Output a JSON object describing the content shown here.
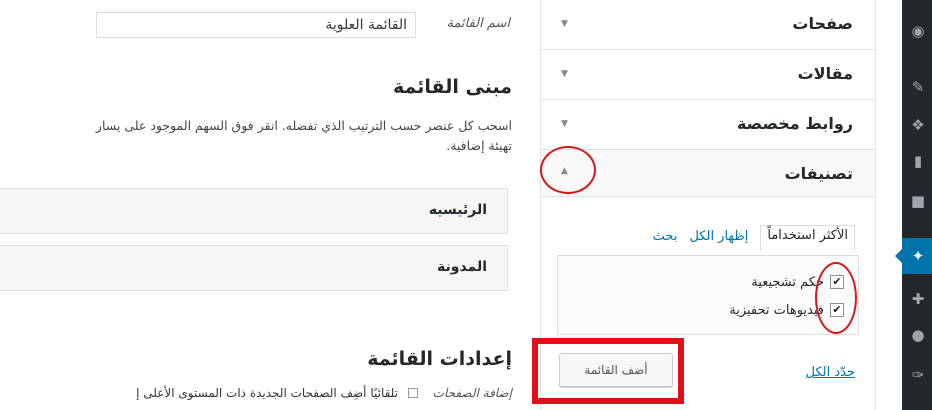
{
  "menu_name": {
    "label": "اسم القائمة",
    "value": "القائمة العلوية"
  },
  "menu_structure": {
    "title": "مبنى القائمة",
    "description": "اسحب كل عنصر حسب الترتيب الذي تفضله. انقر فوق السهم الموجود على يسار",
    "description_2": "تهيئة إضافية.",
    "items": [
      {
        "label": "الرئيسيه"
      },
      {
        "label": "المدونة"
      }
    ]
  },
  "menu_settings": {
    "title": "إعدادات القائمة",
    "auto_add_label": "إضافة الصفحات",
    "auto_add_text": "تلقائيًا أضِف الصفحات الجديدة ذات المستوى الأعلى إ"
  },
  "accordion": {
    "sections": [
      {
        "title": "صفحات"
      },
      {
        "title": "مقالات"
      },
      {
        "title": "روابط مخصصة"
      },
      {
        "title": "تصنيفات"
      }
    ],
    "tabs": [
      "الأكثر استخداماً",
      "إظهار الكل",
      "بحث"
    ],
    "checklist": [
      {
        "label": "حكم تشجيعية",
        "checked": true
      },
      {
        "label": "فيديوهات تحفيزية",
        "checked": true
      }
    ],
    "select_all": "حدّد الكل",
    "add_button": "أضف القائمة"
  },
  "admin_sidebar": {
    "icons": [
      "dashboard-icon",
      "pin-icon",
      "media-icon",
      "pages-icon",
      "comments-icon",
      "appearance-icon",
      "plugins-icon",
      "users-icon",
      "tools-icon"
    ],
    "active_index": 5
  },
  "colors": {
    "accent": "#0073aa",
    "annotation": "#e00f1a",
    "sidebar": "#23282d"
  }
}
